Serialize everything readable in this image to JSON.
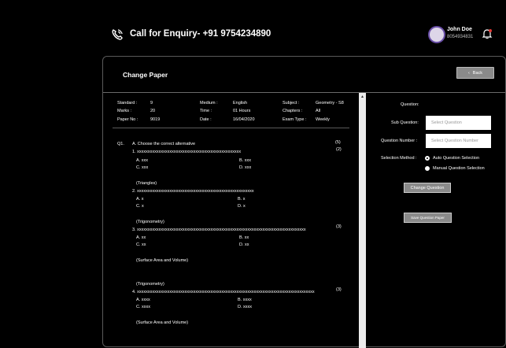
{
  "header": {
    "enquiry": "Call for Enquiry- +91 9754234890",
    "user_name": "John Doe",
    "user_phone": "8054934831"
  },
  "panel": {
    "title": "Change Paper",
    "back_label": "Back"
  },
  "paper_info": {
    "standard_label": "Standard :",
    "standard": "9",
    "marks_label": "Marks :",
    "marks": "20",
    "paper_no_label": "Paper No :",
    "paper_no": "9019",
    "medium_label": "Medium :",
    "medium": "English",
    "time_label": "Time :",
    "time": "01 Hours",
    "date_label": "Date :",
    "date": "16/04/2020",
    "subject_label": "Subject :",
    "subject": "Geometry - S8",
    "chapters_label": "Chapters :",
    "chapters": "All",
    "exam_type_label": "Exam Type :",
    "exam_type": "Weekly"
  },
  "questions": {
    "q_no": "Q1.",
    "heading": "A. Choose the correct alternative",
    "total_marks": "(5)",
    "q1": {
      "text": "1. xxxxxxxxxxxxxxxxxxxxxxxxxxxxxxxxxxxxxxxxxxxxxxxx",
      "marks": "(2)",
      "a": "B. xxx",
      "a0": "A. xxx",
      "c": "C. xxx",
      "d": "D. xxx"
    },
    "q1_chapter": "(Triangles)",
    "q2": {
      "text": "2. xxxxxxxxxxxxxxxxxxxxxxxxxxxxxxxxxxxxxxxxxxxxxxxxxxxxxx",
      "a": "A. x",
      "b": "B. x",
      "c": "C. x",
      "d": "D. x"
    },
    "q2_chapter": "(Trigonometry)",
    "q3": {
      "text": "3. xxxxxxxxxxxxxxxxxxxxxxxxxxxxxxxxxxxxxxxxxxxxxxxxxxxxxxxxxxxxxxxxxxxxxxxxxxxxxx",
      "marks": "(3)",
      "a": "A. xx",
      "b": "B. xx",
      "c": "C. xx",
      "d": "D. xx"
    },
    "q3_chapter": "(Surface Area and Volume)",
    "q4_chapter_pre": "(Trigonometry)",
    "q4": {
      "text": "4. xxxxxxxxxxxxxxxxxxxxxxxxxxxxxxxxxxxxxxxxxxxxxxxxxxxxxxxxxxxxxxxxxxxxxxxxxxxxxxxxxx",
      "marks": "(3)",
      "a": "A. xxxx",
      "b": "B. xxxx",
      "c": "C. xxxx",
      "d": "D. xxxx"
    },
    "q4_chapter": "(Surface Area and Volume)"
  },
  "form": {
    "question_label": "Question:",
    "sub_question_label": "Sub Question:",
    "sub_question_placeholder": "Select Question",
    "question_number_label": "Question Number :",
    "question_number_placeholder": "Select Question Number",
    "selection_method_label": "Selection Method :",
    "auto_label": "Auto Question Selection",
    "manual_label": "Manual Question Selection",
    "change_question": "Change Question",
    "save_paper": "Save Question Paper"
  },
  "colors": {
    "background": "#000000",
    "button_gray": "#8a8a8a",
    "avatar_ring": "#6a4fa8",
    "bell_dot": "#e53935"
  }
}
